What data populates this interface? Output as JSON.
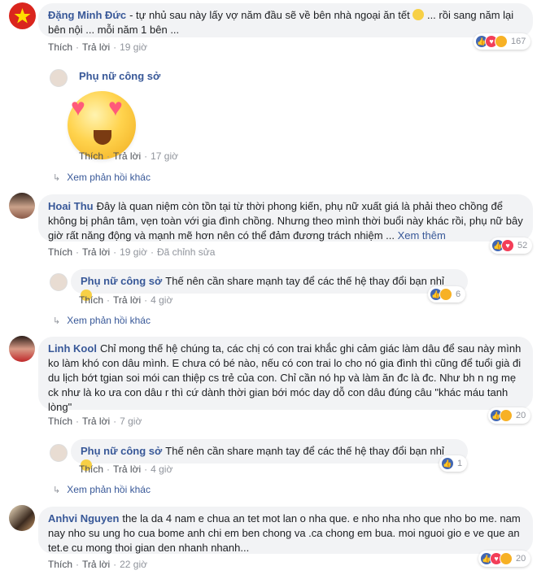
{
  "labels": {
    "like": "Thích",
    "reply": "Trả lời",
    "more_replies": "Xem phản hồi khác",
    "see_more": "Xem thêm",
    "edited": "Đã chỉnh sửa"
  },
  "comments": [
    {
      "name": "Đặng Minh Đức",
      "text1": "- tự nhủ sau này lấy vợ năm đầu sẽ về bên nhà ngoại ăn tết",
      "text2": "... rồi sang năm lại bên nội ... mỗi năm 1 bên ...",
      "time": "19 giờ",
      "reactions": "167",
      "reply": {
        "name": "Phụ nữ công sở",
        "time": "17 giờ"
      }
    },
    {
      "name": "Hoai Thu",
      "text": "Đây là quan niệm còn tồn tại từ thời phong kiến, phụ nữ xuất giá là phải theo chồng để không bị phân tâm, vẹn toàn với gia đình chồng. Nhưng theo mình thời buổi này khác rồi, phụ nữ bây giờ rất năng động và mạnh mẽ hơn nên có thể đảm đương trách nhiệm ...",
      "time": "19 giờ",
      "reactions": "52",
      "reply": {
        "name": "Phụ nữ công sở",
        "text": "Thế nên cần share mạnh tay để các thế hệ thay đổi bạn nhỉ",
        "time": "4 giờ",
        "reactions": "6"
      }
    },
    {
      "name": "Linh Kool",
      "text": "Chỉ mong thế hệ chúng ta, các chị có con trai khắc ghi cảm giác làm dâu để sau này mình ko làm khó con dâu mình. E chưa có bé nào, nếu có con trai lo cho nó gia đình thì cũng để tuổi già đi du lịch bớt tgian soi mói can thiệp cs trẻ của con. Chỉ cần nó hp và làm ăn đc là đc. Như bh n ng mẹ ck như là ko ưa con dâu r thì cứ dành thời gian bới móc day dỗ con dâu đúng câu \"khác máu tanh lòng\"",
      "time": "7 giờ",
      "reactions": "20",
      "reply": {
        "name": "Phụ nữ công sở",
        "text": "Thế nên cần share mạnh tay để các thế hệ thay đổi bạn nhỉ",
        "time": "4 giờ",
        "reactions": "1"
      }
    },
    {
      "name": "Anhvi Nguyen",
      "text": "the la da 4 nam e chua an tet mot lan o nha que. e nho nha nho que nho bo me. nam nay nho su ung ho cua bome anh chi em ben chong va .ca chong em bua. moi nguoi gio e ve que an tet.e cu mong thoi gian den nhanh nhanh...",
      "time": "22 giờ",
      "reactions": "20"
    }
  ],
  "colors": {
    "link": "#385898",
    "bubble": "#f2f3f5",
    "like": "#4267b2",
    "love": "#f33e58",
    "haha": "#f7b125"
  }
}
